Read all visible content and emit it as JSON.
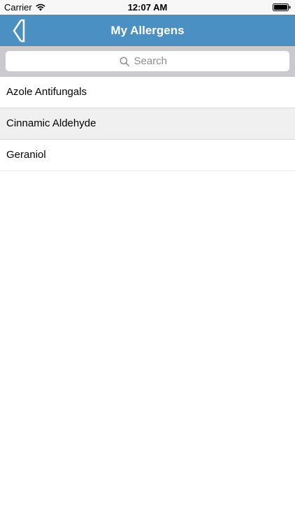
{
  "status_bar": {
    "carrier": "Carrier",
    "time": "12:07 AM",
    "icons": [
      "wifi-icon",
      "battery-icon"
    ]
  },
  "nav": {
    "title": "My Allergens",
    "back_icon": "chevron-left-icon"
  },
  "search": {
    "placeholder": "Search",
    "value": "",
    "icon": "search-icon"
  },
  "allergens": [
    "Azole Antifungals",
    "Cinnamic Aldehyde",
    "Geraniol"
  ],
  "colors": {
    "nav_background": "#4a90c2",
    "search_bar_background": "#c9c9ce",
    "highlighted_row": "#f0f0f0"
  },
  "highlighted_index": 1
}
